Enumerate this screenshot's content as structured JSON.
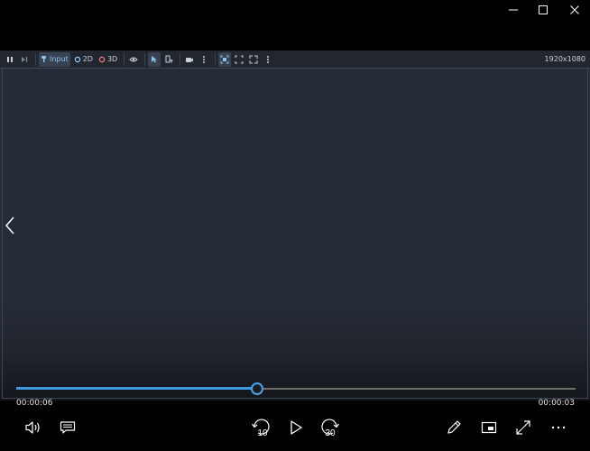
{
  "window": {
    "minimize_icon": "minimize-icon",
    "maximize_icon": "maximize-icon",
    "close_icon": "close-icon"
  },
  "toolbar": {
    "input_label": "Input",
    "mode_2d_label": "2D",
    "mode_3d_label": "3D",
    "resolution": "1920x1080",
    "accent": "#8cc5f5"
  },
  "player": {
    "elapsed": "00:00:06",
    "remaining": "00:00:03",
    "progress": 0.43,
    "accent": "#3f9ae4",
    "controls": {
      "volume": "volume-icon",
      "captions": "captions-icon",
      "rewind": "rewind-10-icon",
      "rewind_label": "10",
      "play": "play-icon",
      "forward": "forward-30-icon",
      "forward_label": "30",
      "edit": "pen-icon",
      "mini_view": "mini-view-icon",
      "fullscreen": "fullscreen-icon",
      "more": "more-icon"
    }
  }
}
